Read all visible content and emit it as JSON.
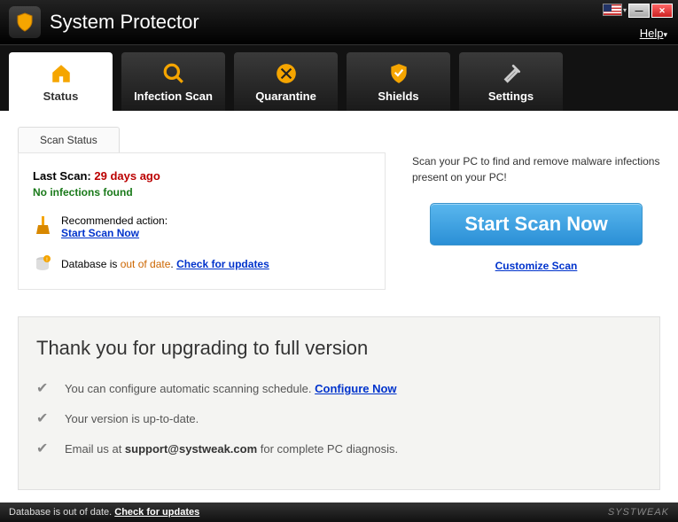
{
  "app": {
    "title": "System Protector"
  },
  "titlebar": {
    "help": "Help"
  },
  "tabs": [
    {
      "label": "Status"
    },
    {
      "label": "Infection Scan"
    },
    {
      "label": "Quarantine"
    },
    {
      "label": "Shields"
    },
    {
      "label": "Settings"
    }
  ],
  "scanStatus": {
    "tabLabel": "Scan Status",
    "lastScanLabel": "Last Scan:",
    "lastScanValue": "29 days ago",
    "noInfections": "No infections found",
    "recommendedLabel": "Recommended action:",
    "recommendedLink": "Start Scan Now",
    "dbPrefix": "Database is ",
    "dbStatus": "out of date",
    "dbSep": ". ",
    "dbLink": "Check for updates"
  },
  "scanPanel": {
    "desc": "Scan your PC to find and remove malware infections present on your PC!",
    "button": "Start Scan Now",
    "customize": "Customize Scan"
  },
  "upgrade": {
    "title": "Thank you for upgrading to full version",
    "row1a": "You can configure automatic scanning schedule. ",
    "row1link": "Configure Now",
    "row2": "Your version is up-to-date.",
    "row3a": "Email us at ",
    "row3email": "support@systweak.com",
    "row3b": " for complete PC diagnosis."
  },
  "statusbar": {
    "text": "Database is out of date. ",
    "link": "Check for updates",
    "brand": "SYSTWEAK"
  }
}
